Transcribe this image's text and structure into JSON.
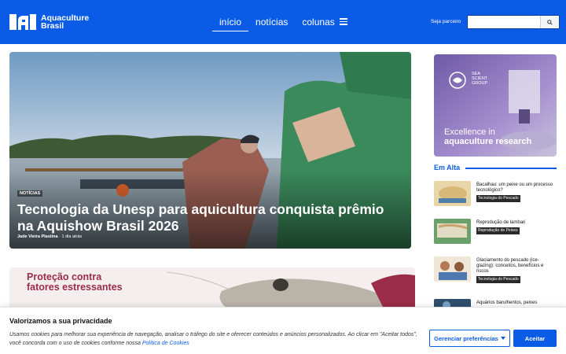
{
  "header": {
    "logo_line1": "Aquaculture",
    "logo_line2": "Brasil",
    "nav": [
      "início",
      "notícias",
      "colunas"
    ],
    "menu_icon": "hamburger-menu-icon",
    "partner_label": "Seja parceiro",
    "search_placeholder": "",
    "search_icon": "search-icon",
    "brand_color": "#0a5ce6"
  },
  "hero": {
    "category": "NOTÍCIAS",
    "title": "Tecnologia da Unesp para aquicultura conquista prêmio na Aquishow Brasil 2026",
    "author": "Jade Vieira Plastina",
    "time": "1 dia atrás"
  },
  "ad_banner": {
    "line1": "Proteção contra",
    "line2": "fatores estressantes",
    "accent_color": "#9b2c4a"
  },
  "sidebar_ad": {
    "brand_line1": "SEA",
    "brand_line2": "SCIENT",
    "brand_line3": "GROUP",
    "text_line1": "Excellence in",
    "text_line2": "aquaculture research"
  },
  "trending": {
    "title": "Em Alta",
    "items": [
      {
        "title": "Bacalhau: um peixe ou um processo tecnológico?",
        "tag": "Tecnologia do Pescado"
      },
      {
        "title": "Reprodução de lambari",
        "tag": "Reprodução de Peixes"
      },
      {
        "title": "Glaciamento do pescado (ice-glazing): conceitos, benefícios e riscos",
        "tag": "Tecnologia do Pescado"
      },
      {
        "title": "Aquários barulhentos, peixes",
        "tag": ""
      }
    ]
  },
  "cookie": {
    "title": "Valorizamos a sua privacidade",
    "text": "Usamos cookies para melhorar sua experiência de navegação, analisar o tráfego do site e oferecer conteúdos e anúncios personalizados. Ao clicar em \"Aceitar todos\", você concorda com o uso de cookies conforme nossa ",
    "link": "Política de Cookies",
    "prefs_button": "Gerenciar preferências",
    "accept_button": "Aceitar"
  }
}
